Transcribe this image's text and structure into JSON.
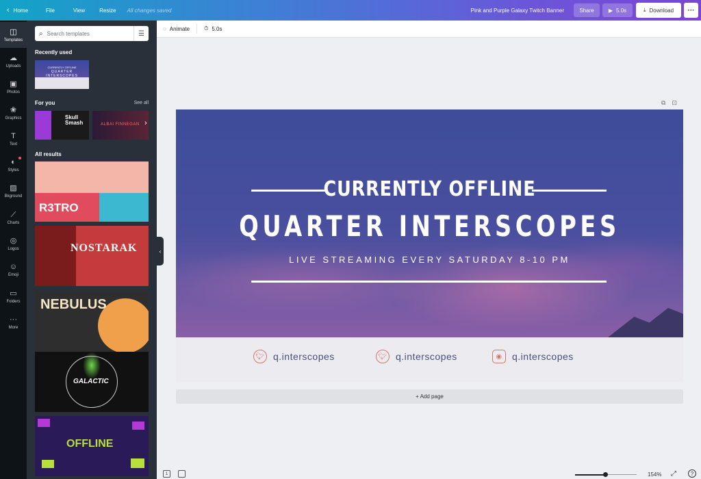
{
  "topbar": {
    "home": "Home",
    "file": "File",
    "view": "View",
    "resize": "Resize",
    "saved_status": "All changes saved",
    "design_title": "Pink and Purple Galaxy Twitch Banner",
    "share": "Share",
    "play_duration": "5.0s",
    "download": "Download"
  },
  "rail": {
    "items": [
      {
        "label": "Templates",
        "icon": "templates-icon"
      },
      {
        "label": "Uploads",
        "icon": "upload-icon"
      },
      {
        "label": "Photos",
        "icon": "photos-icon"
      },
      {
        "label": "Graphics",
        "icon": "graphics-icon"
      },
      {
        "label": "Text",
        "icon": "text-icon"
      },
      {
        "label": "Styles",
        "icon": "styles-icon"
      },
      {
        "label": "Bkground",
        "icon": "background-icon"
      },
      {
        "label": "Charts",
        "icon": "charts-icon"
      },
      {
        "label": "Logos",
        "icon": "logos-icon"
      },
      {
        "label": "Emoji",
        "icon": "emoji-icon"
      },
      {
        "label": "Folders",
        "icon": "folders-icon"
      },
      {
        "label": "More",
        "icon": "more-icon"
      }
    ]
  },
  "panel": {
    "search_placeholder": "Search templates",
    "recently_used": "Recently used",
    "for_you": "For you",
    "see_all": "See all",
    "all_results": "All results",
    "recent_thumb_line1": "CURRENTLY OFFLINE",
    "recent_thumb_line2": "QUARTER INTERSCOPES",
    "for_you_items": [
      "Skull Smash",
      "ALBAI FINNEGAN"
    ],
    "results": [
      "R3TRO",
      "NOSTARAK",
      "NEBULUS",
      "GALACTIC",
      "OFFLINE"
    ]
  },
  "editor": {
    "animate": "Animate",
    "duration": "5.0s",
    "add_page": "+ Add page",
    "zoom": "154%",
    "page_number": "1"
  },
  "banner": {
    "status": "CURRENTLY OFFLINE",
    "channel": "QUARTER INTERSCOPES",
    "schedule": "LIVE STREAMING EVERY SATURDAY 8-10 PM",
    "socials": [
      {
        "handle": "q.interscopes",
        "icon": "twitter-icon"
      },
      {
        "handle": "q.interscopes",
        "icon": "twitter-icon"
      },
      {
        "handle": "q.interscopes",
        "icon": "instagram-icon"
      }
    ]
  },
  "colors": {
    "topbar_start": "#12a4c7",
    "topbar_end": "#7a45d6",
    "rail_bg": "#0e1318",
    "panel_bg": "#293039",
    "social_accent": "#d3756b"
  }
}
